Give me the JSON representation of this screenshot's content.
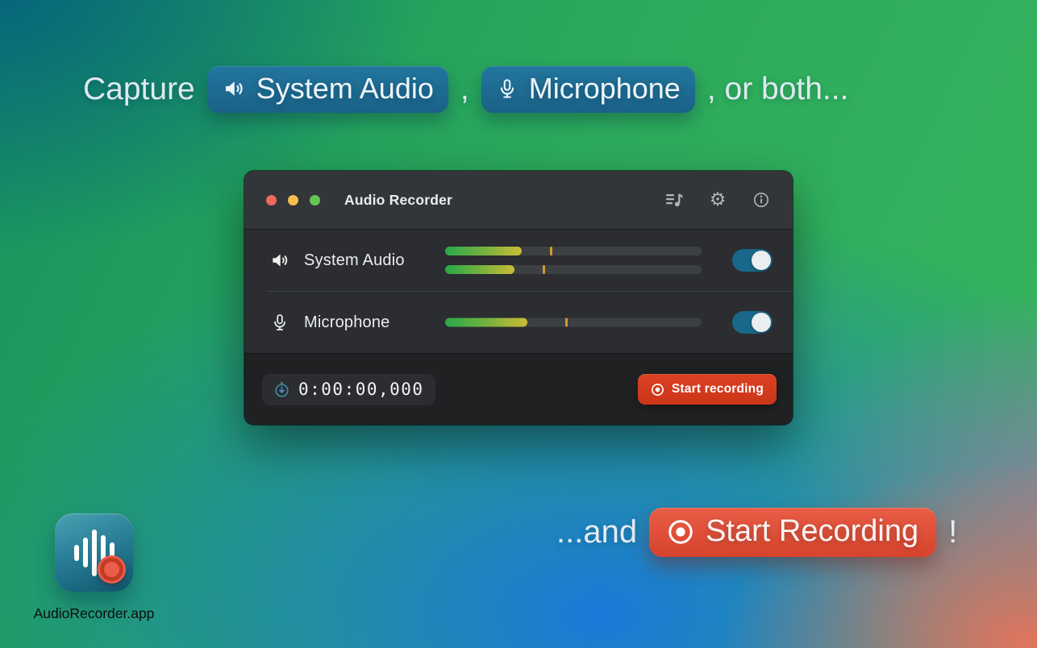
{
  "headline": {
    "capture_text": "Capture",
    "system_audio_label": "System Audio",
    "comma_text": ",",
    "microphone_label": "Microphone",
    "or_both_text": ", or both..."
  },
  "window": {
    "title": "Audio Recorder",
    "rows": [
      {
        "label": "System Audio",
        "enabled": true,
        "meters": [
          {
            "fill_pct": 30,
            "peak_pct": 41
          },
          {
            "fill_pct": 27,
            "peak_pct": 38
          }
        ]
      },
      {
        "label": "Microphone",
        "enabled": true,
        "meters": [
          {
            "fill_pct": 32,
            "peak_pct": 47
          }
        ]
      }
    ],
    "timer_value": "0:00:00,000",
    "start_button_label": "Start recording"
  },
  "footer": {
    "and_text": "...and",
    "start_badge_label": "Start Recording",
    "exclamation_text": "!"
  },
  "desktop_icon": {
    "label": "AudioRecorder.app"
  },
  "icons": {
    "gear_glyph": "⚙"
  },
  "colors": {
    "record_red": "#d13a20",
    "badge_red": "#e0513a",
    "badge_teal": "#1e6d92",
    "toggle_teal": "#19688a",
    "meter_green": "#28a94a",
    "meter_yellow": "#cdbc33",
    "peak_amber": "#d29a33",
    "traffic_red": "#ed6a5e",
    "traffic_yellow": "#f5bf4f",
    "traffic_green": "#62c554"
  }
}
